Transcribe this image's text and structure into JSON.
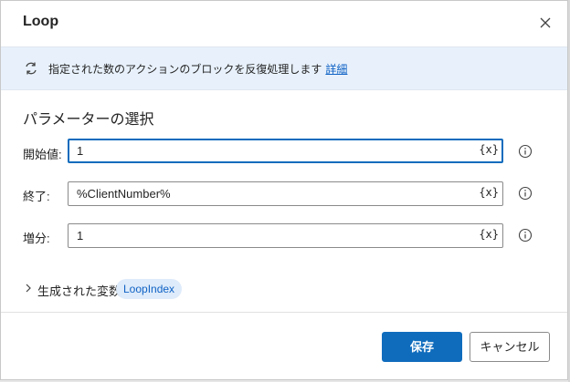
{
  "dialog": {
    "title": "Loop"
  },
  "info": {
    "text": "指定された数のアクションのブロックを反復処理します",
    "link": "詳細"
  },
  "section": {
    "title": "パラメーターの選択"
  },
  "params": [
    {
      "label": "開始値:",
      "value": "1",
      "var_button": "{x}"
    },
    {
      "label": "終了:",
      "value": "%ClientNumber%",
      "var_button": "{x}"
    },
    {
      "label": "増分:",
      "value": "1",
      "var_button": "{x}"
    }
  ],
  "generated": {
    "label": "生成された変数",
    "variable": "LoopIndex"
  },
  "footer": {
    "save_label": "保存",
    "cancel_label": "キャンセル"
  },
  "colors": {
    "accent": "#0f6cbd",
    "info_bg": "#e8f1fb",
    "chip_bg": "#deebfa"
  },
  "icons": {
    "close": "close-icon",
    "info": "loop-icon",
    "help": "info-circle-icon",
    "expand": "chevron-right-icon"
  }
}
